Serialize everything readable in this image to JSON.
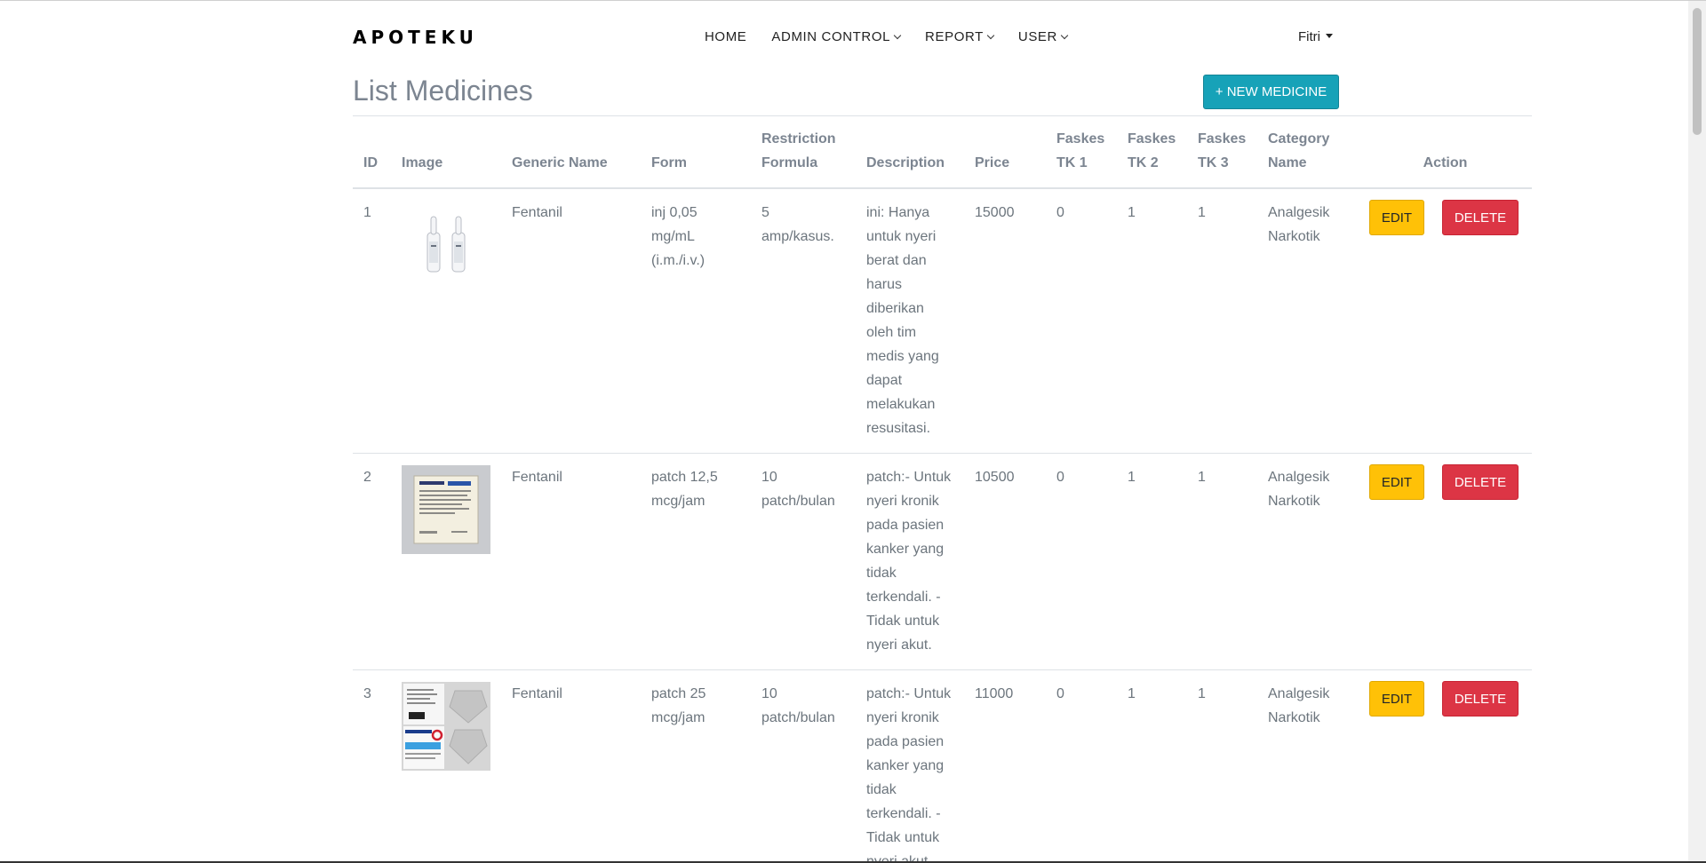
{
  "navbar": {
    "brand": "APOTEKU",
    "items": [
      {
        "label": "HOME"
      },
      {
        "label": "ADMIN CONTROL"
      },
      {
        "label": "REPORT"
      },
      {
        "label": "USER"
      }
    ],
    "user": "Fitri"
  },
  "page": {
    "title": "List Medicines",
    "new_button": "+ NEW MEDICINE"
  },
  "table": {
    "headers": {
      "id": "ID",
      "image": "Image",
      "generic": "Generic Name",
      "form": "Form",
      "restriction": "Restriction Formula",
      "description": "Description",
      "price": "Price",
      "tk1": "Faskes TK 1",
      "tk2": "Faskes TK 2",
      "tk3": "Faskes TK 3",
      "category": "Category Name",
      "action": "Action"
    },
    "edit_label": "EDIT",
    "delete_label": "DELETE",
    "rows": [
      {
        "id": "1",
        "image_icon": "ampoule-icon",
        "generic": "Fentanil",
        "form": "inj 0,05 mg/mL (i.m./i.v.)",
        "restriction": "5 amp/kasus.",
        "description": "ini: Hanya untuk nyeri berat dan harus diberikan oleh tim medis yang dapat melakukan resusitasi.",
        "price": "15000",
        "tk1": "0",
        "tk2": "1",
        "tk3": "1",
        "category": "Analgesik Narkotik"
      },
      {
        "id": "2",
        "image_icon": "patch-sachet-icon",
        "generic": "Fentanil",
        "form": "patch 12,5 mcg/jam",
        "restriction": "10 patch/bulan",
        "description": "patch:- Untuk nyeri kronik pada pasien kanker yang tidak terkendali. - Tidak untuk nyeri akut.",
        "price": "10500",
        "tk1": "0",
        "tk2": "1",
        "tk3": "1",
        "category": "Analgesik Narkotik"
      },
      {
        "id": "3",
        "image_icon": "patch-package-icon",
        "generic": "Fentanil",
        "form": "patch 25 mcg/jam",
        "restriction": "10 patch/bulan",
        "description": "patch:- Untuk nyeri kronik pada pasien kanker yang tidak terkendali. - Tidak untuk nyeri akut.",
        "price": "11000",
        "tk1": "0",
        "tk2": "1",
        "tk3": "1",
        "category": "Analgesik Narkotik"
      }
    ]
  }
}
